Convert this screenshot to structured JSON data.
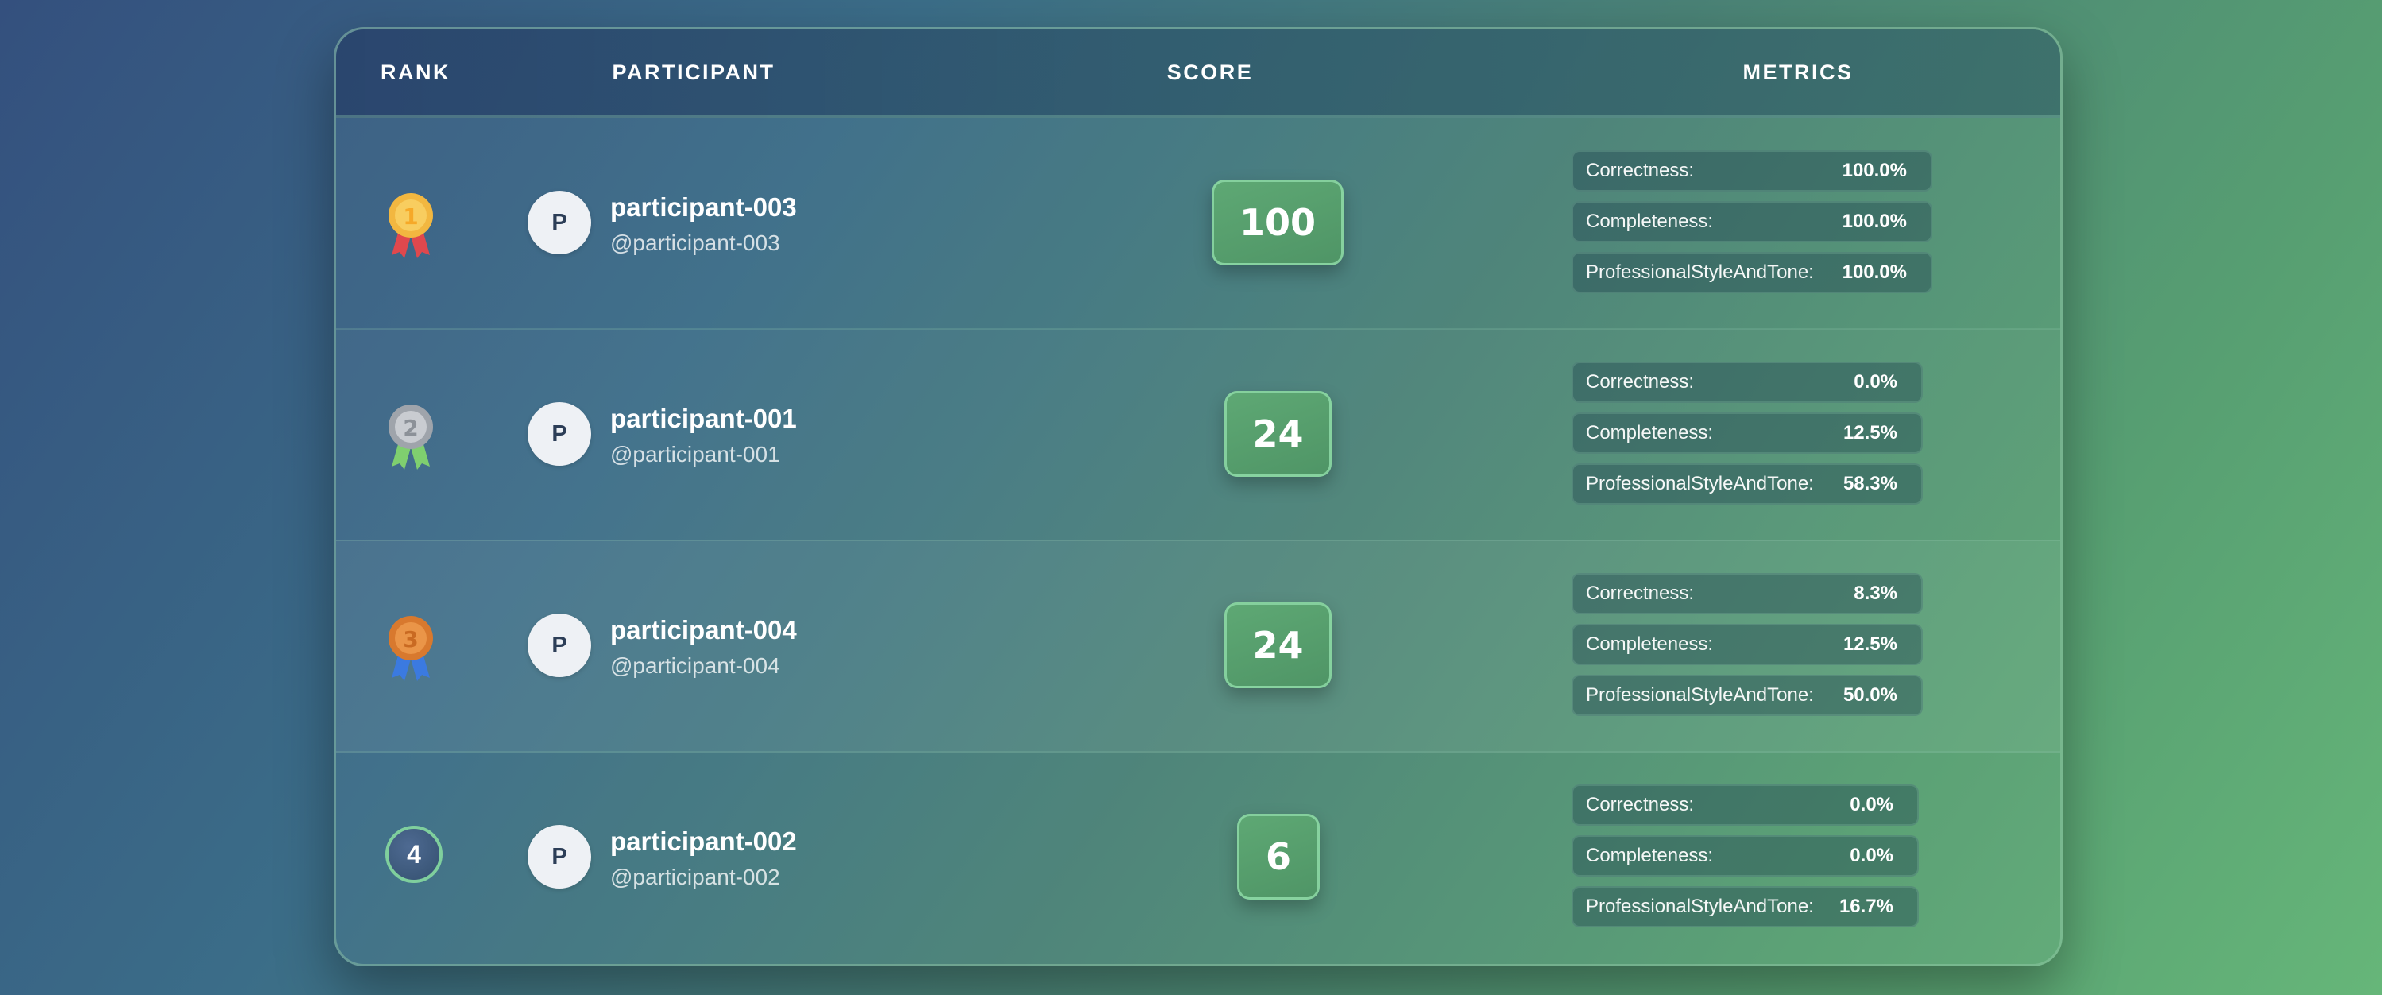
{
  "header": {
    "rank": "RANK",
    "participant": "PARTICIPANT",
    "score": "SCORE",
    "metrics": "METRICS"
  },
  "colors": {
    "gold_medal": "#f2b740",
    "silver_medal": "#b9bdc3",
    "bronze_medal": "#e0883a",
    "score_badge": "#5ea874"
  },
  "rows": [
    {
      "rank": "1",
      "rank_icon": "gold-medal-icon",
      "avatar": "P",
      "name": "participant-003",
      "handle": "@participant-003",
      "score": "100",
      "metrics": [
        {
          "label": "Correctness:",
          "value": "100.0%"
        },
        {
          "label": "Completeness:",
          "value": "100.0%"
        },
        {
          "label": "ProfessionalStyleAndTone:",
          "value": "100.0%"
        }
      ]
    },
    {
      "rank": "2",
      "rank_icon": "silver-medal-icon",
      "avatar": "P",
      "name": "participant-001",
      "handle": "@participant-001",
      "score": "24",
      "metrics": [
        {
          "label": "Correctness:",
          "value": "0.0%"
        },
        {
          "label": "Completeness:",
          "value": "12.5%"
        },
        {
          "label": "ProfessionalStyleAndTone:",
          "value": "58.3%"
        }
      ]
    },
    {
      "rank": "3",
      "rank_icon": "bronze-medal-icon",
      "avatar": "P",
      "name": "participant-004",
      "handle": "@participant-004",
      "score": "24",
      "metrics": [
        {
          "label": "Correctness:",
          "value": "8.3%"
        },
        {
          "label": "Completeness:",
          "value": "12.5%"
        },
        {
          "label": "ProfessionalStyleAndTone:",
          "value": "50.0%"
        }
      ]
    },
    {
      "rank": "4",
      "rank_icon": "rank-badge",
      "avatar": "P",
      "name": "participant-002",
      "handle": "@participant-002",
      "score": "6",
      "metrics": [
        {
          "label": "Correctness:",
          "value": "0.0%"
        },
        {
          "label": "Completeness:",
          "value": "0.0%"
        },
        {
          "label": "ProfessionalStyleAndTone:",
          "value": "16.7%"
        }
      ]
    }
  ]
}
